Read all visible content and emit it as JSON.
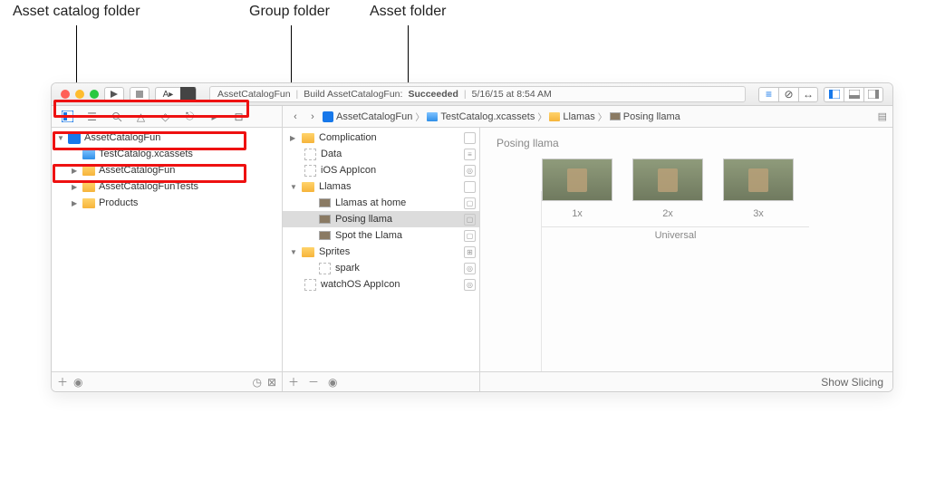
{
  "callouts": {
    "asset_catalog": "Asset catalog folder",
    "group_folder": "Group folder",
    "asset_folder": "Asset folder"
  },
  "toolbar": {
    "status_project": "AssetCatalogFun",
    "status_action": "Build AssetCatalogFun:",
    "status_result": "Succeeded",
    "status_time": "5/16/15 at 8:54 AM"
  },
  "jumpbar": {
    "items": [
      "AssetCatalogFun",
      "TestCatalog.xcassets",
      "Llamas",
      "Posing llama"
    ]
  },
  "navigator": {
    "root": "AssetCatalogFun",
    "items": [
      "TestCatalog.xcassets",
      "AssetCatalogFun",
      "AssetCatalogFunTests",
      "Products"
    ]
  },
  "outline": {
    "items": [
      {
        "label": "Complication",
        "kind": "folder"
      },
      {
        "label": "Data",
        "kind": "item"
      },
      {
        "label": "iOS AppIcon",
        "kind": "appicon"
      },
      {
        "label": "Llamas",
        "kind": "folder",
        "open": true
      },
      {
        "label": "Llamas at home",
        "kind": "image",
        "indent": 2
      },
      {
        "label": "Posing llama",
        "kind": "image",
        "indent": 2,
        "selected": true
      },
      {
        "label": "Spot the Llama",
        "kind": "image",
        "indent": 2
      },
      {
        "label": "Sprites",
        "kind": "folder",
        "open": true
      },
      {
        "label": "spark",
        "kind": "item",
        "indent": 2
      },
      {
        "label": "watchOS AppIcon",
        "kind": "appicon"
      }
    ]
  },
  "editor": {
    "title": "Posing llama",
    "wells": [
      "1x",
      "2x",
      "3x"
    ],
    "group": "Universal",
    "footer": "Show Slicing"
  }
}
